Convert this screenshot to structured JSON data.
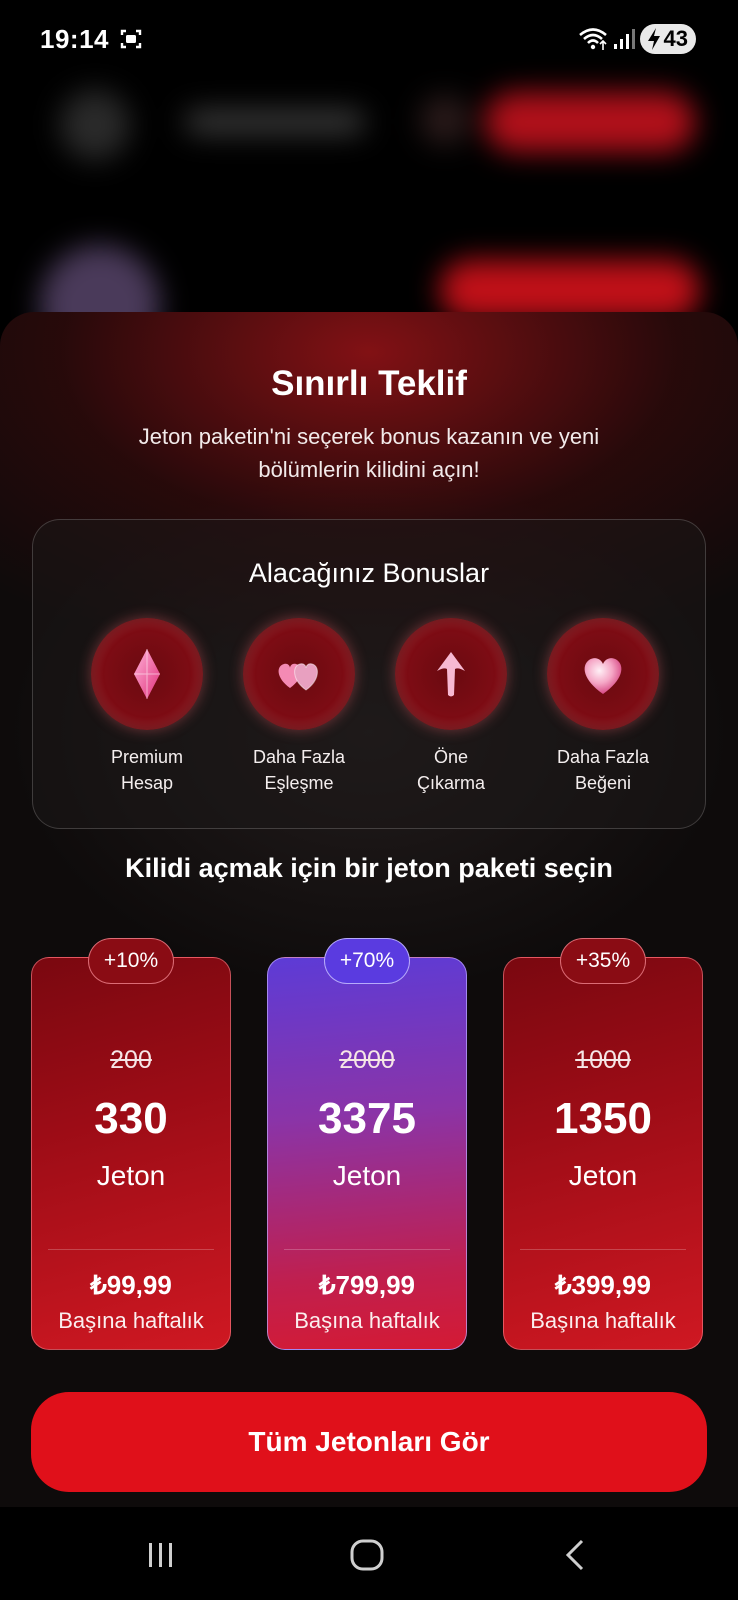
{
  "status_bar": {
    "time": "19:14",
    "battery": "43"
  },
  "offer": {
    "title": "Sınırlı Teklif",
    "subtitle": "Jeton paketin'ni seçerek bonus kazanın ve yeni bölümlerin kilidini açın!"
  },
  "bonuses": {
    "title": "Alacağınız Bonuslar",
    "items": [
      {
        "label": "Premium\nHesap",
        "icon": "gem-icon"
      },
      {
        "label": "Daha Fazla\nEşleşme",
        "icon": "hearts-icon"
      },
      {
        "label": "Öne\nÇıkarma",
        "icon": "boost-arrow-icon"
      },
      {
        "label": "Daha Fazla\nBeğeni",
        "icon": "heart-icon"
      }
    ]
  },
  "packages": {
    "title": "Kilidi açmak için bir jeton paketi seçin",
    "items": [
      {
        "badge": "+10%",
        "old": "200",
        "amount": "330",
        "unit": "Jeton",
        "price": "₺99,99",
        "period": "Başına haftalık"
      },
      {
        "badge": "+70%",
        "old": "2000",
        "amount": "3375",
        "unit": "Jeton",
        "price": "₺799,99",
        "period": "Başına haftalık"
      },
      {
        "badge": "+35%",
        "old": "1000",
        "amount": "1350",
        "unit": "Jeton",
        "price": "₺399,99",
        "period": "Başına haftalık"
      }
    ]
  },
  "cta": {
    "label": "Tüm Jetonları Gör"
  },
  "colors": {
    "accent": "#e0101a",
    "highlight": "#5d3bd6"
  }
}
